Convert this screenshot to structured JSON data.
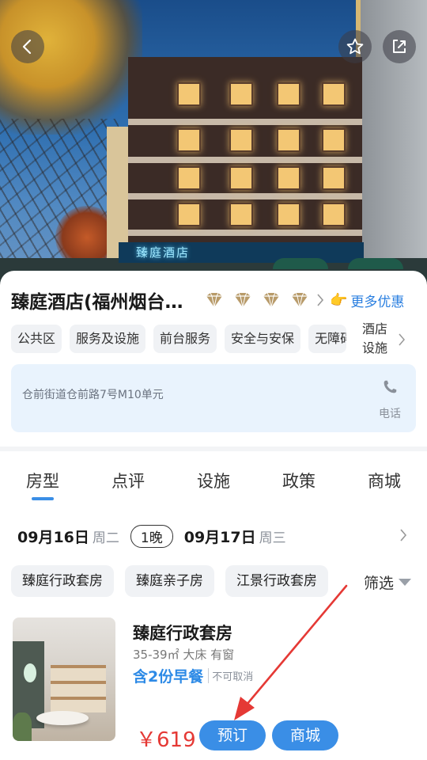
{
  "colors": {
    "accent": "#3a8ee6",
    "price": "#e53935",
    "address_bg": "#e9f3fd",
    "annotation_arrow": "#e53935"
  },
  "header": {
    "back_icon": "chevron-left-icon",
    "favorite_icon": "star-icon",
    "share_icon": "share-icon",
    "sign_text": "臻庭酒店"
  },
  "hotel": {
    "name": "臻庭酒店(福州烟台…",
    "diamond_rating": 4,
    "more_deals": "更多优惠",
    "facilities": [
      "公共区",
      "服务及设施",
      "前台服务",
      "安全与安保",
      "无障碍"
    ],
    "facilities_link": "酒店设施",
    "address": "仓前街道仓前路7号M10单元",
    "phone_label": "电话"
  },
  "tabs": [
    "房型",
    "点评",
    "设施",
    "政策",
    "商城"
  ],
  "active_tab": 0,
  "dates": {
    "checkin": "09月16日",
    "checkin_dow": "周二",
    "nights": "1晚",
    "checkout": "09月17日",
    "checkout_dow": "周三"
  },
  "room_filters": [
    "臻庭行政套房",
    "臻庭亲子房",
    "江景行政套房"
  ],
  "filter_label": "筛选",
  "room": {
    "name": "臻庭行政套房",
    "spec": "35-39㎡ 大床 有窗",
    "breakfast": "含2份早餐",
    "cancel_policy": "不可取消",
    "price": "￥619",
    "book_label": "预订",
    "mall_label": "商城"
  }
}
